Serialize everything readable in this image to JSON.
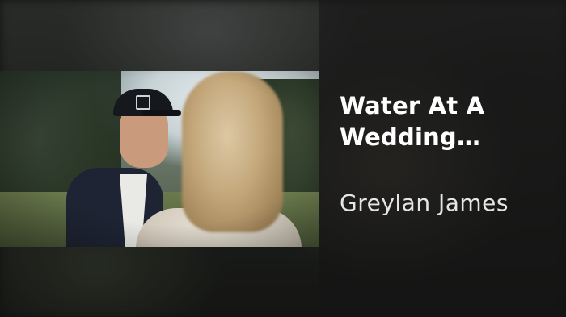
{
  "track": {
    "title": "Water At A Wedding…",
    "artist": "Greylan James"
  },
  "colors": {
    "background": "#1a1b1a",
    "title_text": "#ffffff",
    "artist_text": "#e6e6e6"
  }
}
